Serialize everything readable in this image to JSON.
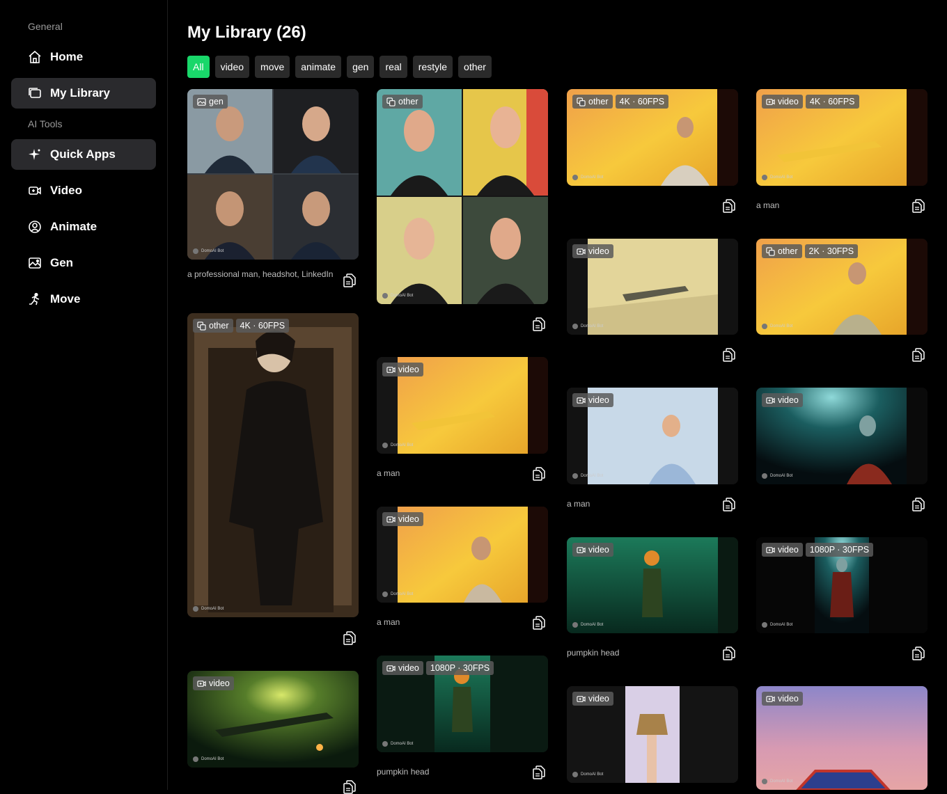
{
  "sidebar": {
    "general_label": "General",
    "ai_tools_label": "AI Tools",
    "nav": {
      "home": "Home",
      "library": "My Library",
      "quick_apps": "Quick Apps",
      "video": "Video",
      "animate": "Animate",
      "gen": "Gen",
      "move": "Move"
    }
  },
  "library": {
    "title": "My Library (26)",
    "filters": [
      "All",
      "video",
      "move",
      "animate",
      "gen",
      "real",
      "restyle",
      "other"
    ],
    "active_filter": "All",
    "accent": "#19d76a"
  },
  "cards": [
    {
      "tag": "gen",
      "quality": "",
      "caption": "a professional man, headshot, LinkedIn",
      "icon": "image-icon"
    },
    {
      "tag": "other",
      "quality": "4K · 60FPS",
      "caption": "",
      "icon": "swap-icon"
    },
    {
      "tag": "video",
      "quality": "",
      "caption": "",
      "icon": "video-icon"
    },
    {
      "tag": "other",
      "quality": "",
      "caption": "",
      "icon": "swap-icon"
    },
    {
      "tag": "video",
      "quality": "",
      "caption": "a man",
      "icon": "video-icon"
    },
    {
      "tag": "video",
      "quality": "",
      "caption": "a man",
      "icon": "video-icon"
    },
    {
      "tag": "video",
      "quality": "1080P · 30FPS",
      "caption": "pumpkin head",
      "icon": "video-icon"
    },
    {
      "tag": "other",
      "quality": "4K · 60FPS",
      "caption": "",
      "icon": "swap-icon"
    },
    {
      "tag": "video",
      "quality": "",
      "caption": "",
      "icon": "video-icon"
    },
    {
      "tag": "video",
      "quality": "",
      "caption": "a man",
      "icon": "video-icon"
    },
    {
      "tag": "video",
      "quality": "",
      "caption": "pumpkin head",
      "icon": "video-icon"
    },
    {
      "tag": "video",
      "quality": "",
      "caption": "",
      "icon": "video-icon"
    },
    {
      "tag": "video",
      "quality": "4K · 60FPS",
      "caption": "a man",
      "icon": "video-icon"
    },
    {
      "tag": "other",
      "quality": "2K · 30FPS",
      "caption": "",
      "icon": "swap-icon"
    },
    {
      "tag": "video",
      "quality": "",
      "caption": "",
      "icon": "video-icon"
    },
    {
      "tag": "video",
      "quality": "1080P · 30FPS",
      "caption": "",
      "icon": "video-icon"
    },
    {
      "tag": "video",
      "quality": "",
      "caption": "",
      "icon": "video-icon"
    }
  ],
  "watermark": "DomoAI Bot"
}
